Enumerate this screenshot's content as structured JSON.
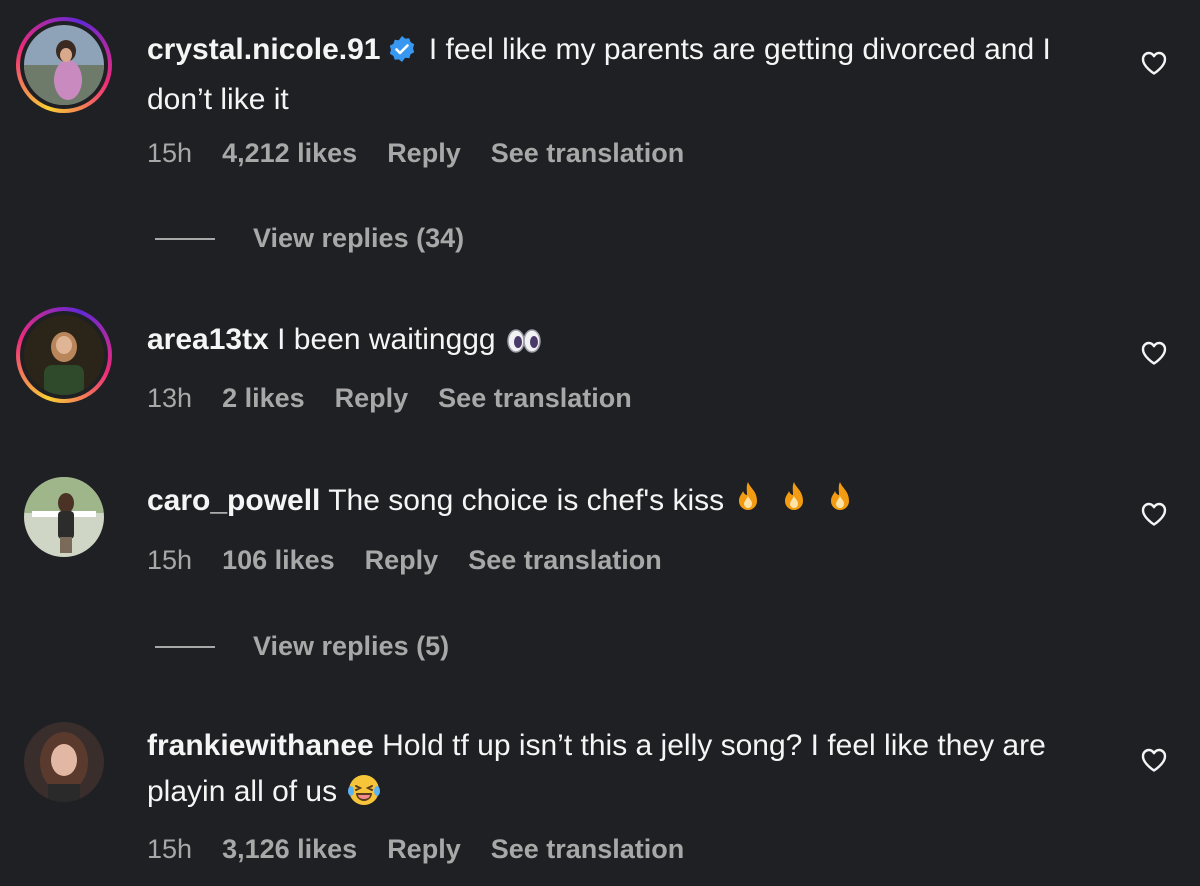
{
  "comments": [
    {
      "username": "crystal.nicole.91",
      "verified": true,
      "text": "I feel like my parents are getting divorced and I don’t like it",
      "time": "15h",
      "likes": "4,212 likes",
      "reply": "Reply",
      "translate": "See translation",
      "view_replies": "View replies (34)",
      "avatar_ring": true
    },
    {
      "username": "area13tx",
      "verified": false,
      "text": "I been waitinggg",
      "emoji": "eyes",
      "time": "13h",
      "likes": "2 likes",
      "reply": "Reply",
      "translate": "See translation",
      "avatar_ring": true
    },
    {
      "username": "caro_powell",
      "verified": false,
      "text": "The song choice is chef's kiss",
      "emoji": "fire fire fire",
      "time": "15h",
      "likes": "106 likes",
      "reply": "Reply",
      "translate": "See translation",
      "view_replies": "View replies (5)",
      "avatar_ring": false
    },
    {
      "username": "frankiewithanee",
      "verified": false,
      "text": "Hold tf up isn’t this a jelly song? I feel like they are playin all of us",
      "emoji": "laughing-crying",
      "time": "15h",
      "likes": "3,126 likes",
      "reply": "Reply",
      "translate": "See translation",
      "avatar_ring": false
    }
  ],
  "colors": {
    "background": "#1f2023",
    "primary_text": "#f5f5f5",
    "secondary_text": "#a8a8a8",
    "verified_blue": "#3897f0"
  },
  "icons": {
    "like": "heart-outline-icon",
    "verified": "verified-badge-icon"
  }
}
